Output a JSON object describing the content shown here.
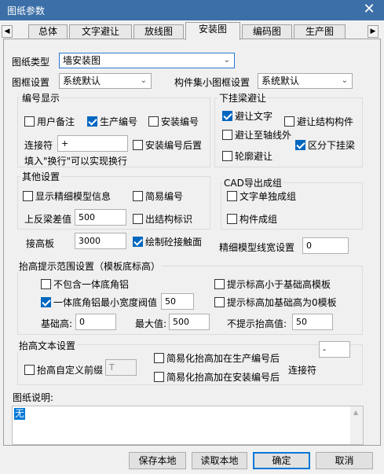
{
  "window": {
    "title": "图纸参数",
    "close_glyph": "✕"
  },
  "tabs": [
    {
      "label": "总体"
    },
    {
      "label": "文字避让"
    },
    {
      "label": "放线图"
    },
    {
      "label": "安装图",
      "active": true
    },
    {
      "label": "编码图"
    },
    {
      "label": "生产图"
    }
  ],
  "tab_scroll": {
    "left": "◀",
    "right": "▶"
  },
  "drawing_type": {
    "label": "图纸类型",
    "value": "墙安装图"
  },
  "frame": {
    "label": "图框设置",
    "value": "系统默认"
  },
  "component_frame": {
    "label": "构件集小图框设置",
    "value": "系统默认"
  },
  "numbering": {
    "title": "编号显示",
    "user_note": {
      "label": "用户备注",
      "checked": false
    },
    "production_no": {
      "label": "生产编号",
      "checked": true
    },
    "install_no": {
      "label": "安装编号",
      "checked": false
    },
    "connector_label": "连接符",
    "connector_value": "+",
    "install_suffix": {
      "label": "安装编号后置",
      "checked": false
    },
    "hint": "填入\"换行\"可以实现换行"
  },
  "hanging_avoid": {
    "title": "下挂梁避让",
    "avoid_text": {
      "label": "避让文字",
      "checked": true
    },
    "avoid_struct": {
      "label": "避让结构构件",
      "checked": false
    },
    "avoid_axis": {
      "label": "避让至轴线外",
      "checked": false
    },
    "split_hanging": {
      "label": "区分下挂梁",
      "checked": true
    },
    "avoid_outline": {
      "label": "轮廓避让",
      "checked": false
    }
  },
  "other": {
    "title": "其他设置",
    "fine_model": {
      "label": "显示精细模型信息",
      "checked": false
    },
    "simple_no": {
      "label": "简易编号",
      "checked": false
    },
    "beam_diff_label": "上反梁差值",
    "beam_diff_value": "500",
    "struct_mark": {
      "label": "出结构标识",
      "checked": false
    },
    "slab_label": "接高板",
    "slab_value": "3000",
    "draw_contact": {
      "label": "绘制砼接触面",
      "checked": true
    },
    "line_width_label": "精细模型线宽设置",
    "line_width_value": "0"
  },
  "cad": {
    "title": "CAD导出成组",
    "text_group": {
      "label": "文字单独成组",
      "checked": false
    },
    "comp_group": {
      "label": "构件成组",
      "checked": false
    }
  },
  "raise": {
    "title": "抬高提示范围设置（模板底标高）",
    "exclude_corner": {
      "label": "不包含一体底角铝",
      "checked": false
    },
    "below_base": {
      "label": "提示标高小于基础高模板",
      "checked": false
    },
    "min_width": {
      "label": "一体底角铝最小宽度阀值",
      "checked": true,
      "value": "50"
    },
    "zero_base": {
      "label": "提示标高加基础高为0模板",
      "checked": false
    },
    "base_label": "基础高:",
    "base_value": "0",
    "max_label": "最大值:",
    "max_value": "500",
    "no_tip_label": "不提示抬高值:",
    "no_tip_value": "50"
  },
  "raise_text": {
    "title": "抬高文本设置",
    "custom_prefix": {
      "label": "抬高自定义前缀",
      "checked": false,
      "value": "T"
    },
    "add_production": {
      "label": "简易化抬高加在生产编号后",
      "checked": false
    },
    "add_install": {
      "label": "简易化抬高加在安装编号后",
      "checked": false
    },
    "connector_value": "-",
    "connector_label": "连接符"
  },
  "notes": {
    "label": "图纸说明:",
    "value": "无",
    "scroll_glyph": "▲"
  },
  "buttons": {
    "save_local": "保存本地",
    "read_local": "读取本地",
    "ok": "确定",
    "cancel": "取消"
  }
}
